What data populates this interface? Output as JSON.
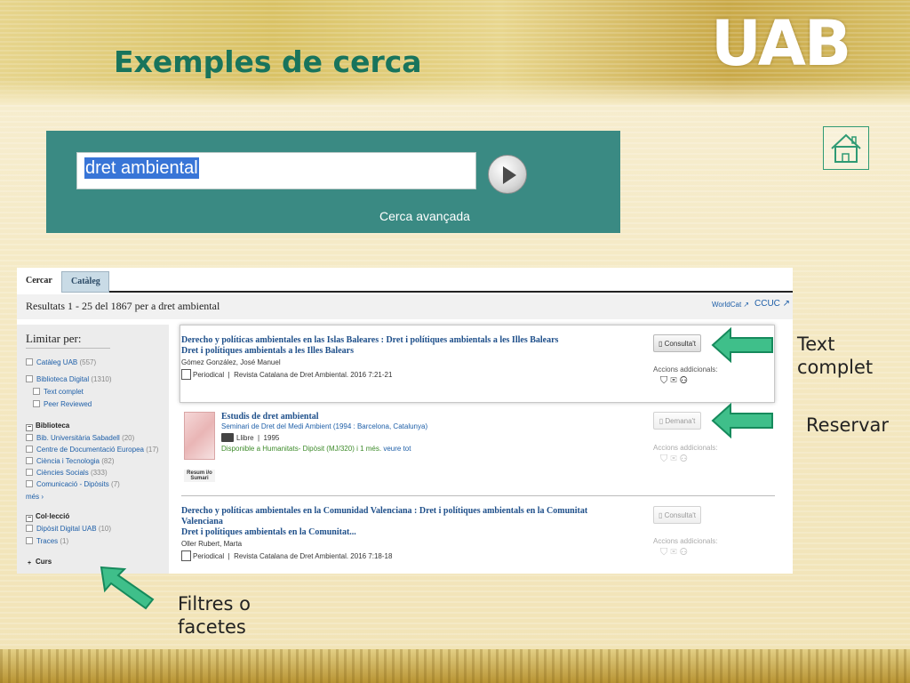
{
  "slide": {
    "title": "Exemples de cerca",
    "logo": "UAB"
  },
  "search": {
    "query": "dret ambiental",
    "advanced_link": "Cerca avançada",
    "go_icon": "play-arrow-icon"
  },
  "home_icon": "house-icon",
  "catalog": {
    "tabs": [
      "Cercar",
      "Catàleg"
    ],
    "results_summary": "Resultats 1 - 25 del 1867 per a dret ambiental",
    "external_links": [
      "WorldCat",
      "CCUC"
    ],
    "facets": {
      "heading": "Limitar per:",
      "top": [
        {
          "label": "Catàleg UAB",
          "count": "(557)"
        },
        {
          "label": "Biblioteca Digital",
          "count": "(1310)"
        }
      ],
      "digital_sub": [
        {
          "label": "Text complet",
          "count": ""
        },
        {
          "label": "Peer Reviewed",
          "count": ""
        }
      ],
      "biblioteca_heading": "Biblioteca",
      "biblioteca": [
        {
          "label": "Bib. Universitària Sabadell",
          "count": "(20)"
        },
        {
          "label": "Centre de Documentació Europea",
          "count": "(17)"
        },
        {
          "label": "Ciència i Tecnologia",
          "count": "(82)"
        },
        {
          "label": "Ciències Socials",
          "count": "(333)"
        },
        {
          "label": "Comunicació - Dipòsits",
          "count": "(7)"
        }
      ],
      "more": "més ›",
      "colleccio_heading": "Col·lecció",
      "colleccio": [
        {
          "label": "Dipòsit Digital UAB",
          "count": "(10)"
        },
        {
          "label": "Traces",
          "count": "(1)"
        }
      ],
      "curs_heading": "Curs"
    },
    "records": [
      {
        "title1": "Derecho y políticas ambientales en las Islas Baleares : Dret i polítiques ambientals a les Illes Balears",
        "title2": "Dret i polítiques ambientals a les Illes Balears",
        "author": "Gómez González, José Manuel",
        "type": "Periodical",
        "source": "Revista Catalana de Dret Ambiental. 2016 7:21-21",
        "button": "Consulta't",
        "accions": "Accions addicionals:"
      },
      {
        "title1": "Estudis de dret ambiental",
        "subtitle": "Seminari de Dret del Medi Ambient (1994 : Barcelona, Catalunya)",
        "type": "Llibre",
        "year": "1995",
        "availability_prefix": "Disponible",
        "availability_rest": "a Humanitats- Dipòsit (MJ/320) i 1 més.",
        "see_all": "veure tot",
        "cover_caption": "Resum i/o Sumari",
        "button": "Demana't",
        "accions": "Accions addicionals:"
      },
      {
        "title1": "Derecho y políticas ambientales en la Comunidad Valenciana : Dret i polítiques ambientals en la Comunitat Valenciana",
        "title2": "Dret i polítiques ambientals en la Comunitat...",
        "author": "Oller Rubert, Marta",
        "type": "Periodical",
        "source": "Revista Catalana de Dret Ambiental. 2016 7:18-18",
        "button": "Consulta't",
        "accions": "Accions addicionals:"
      }
    ]
  },
  "annotations": {
    "text_complet": [
      "Text",
      "complet"
    ],
    "reservar": "Reservar",
    "filtres": [
      "Filtres o",
      "facetes"
    ]
  },
  "colors": {
    "title_green": "#18745c",
    "search_teal": "#3a8a83",
    "arrow_green": "#3fbf8a",
    "link_blue": "#1e5fa8"
  }
}
